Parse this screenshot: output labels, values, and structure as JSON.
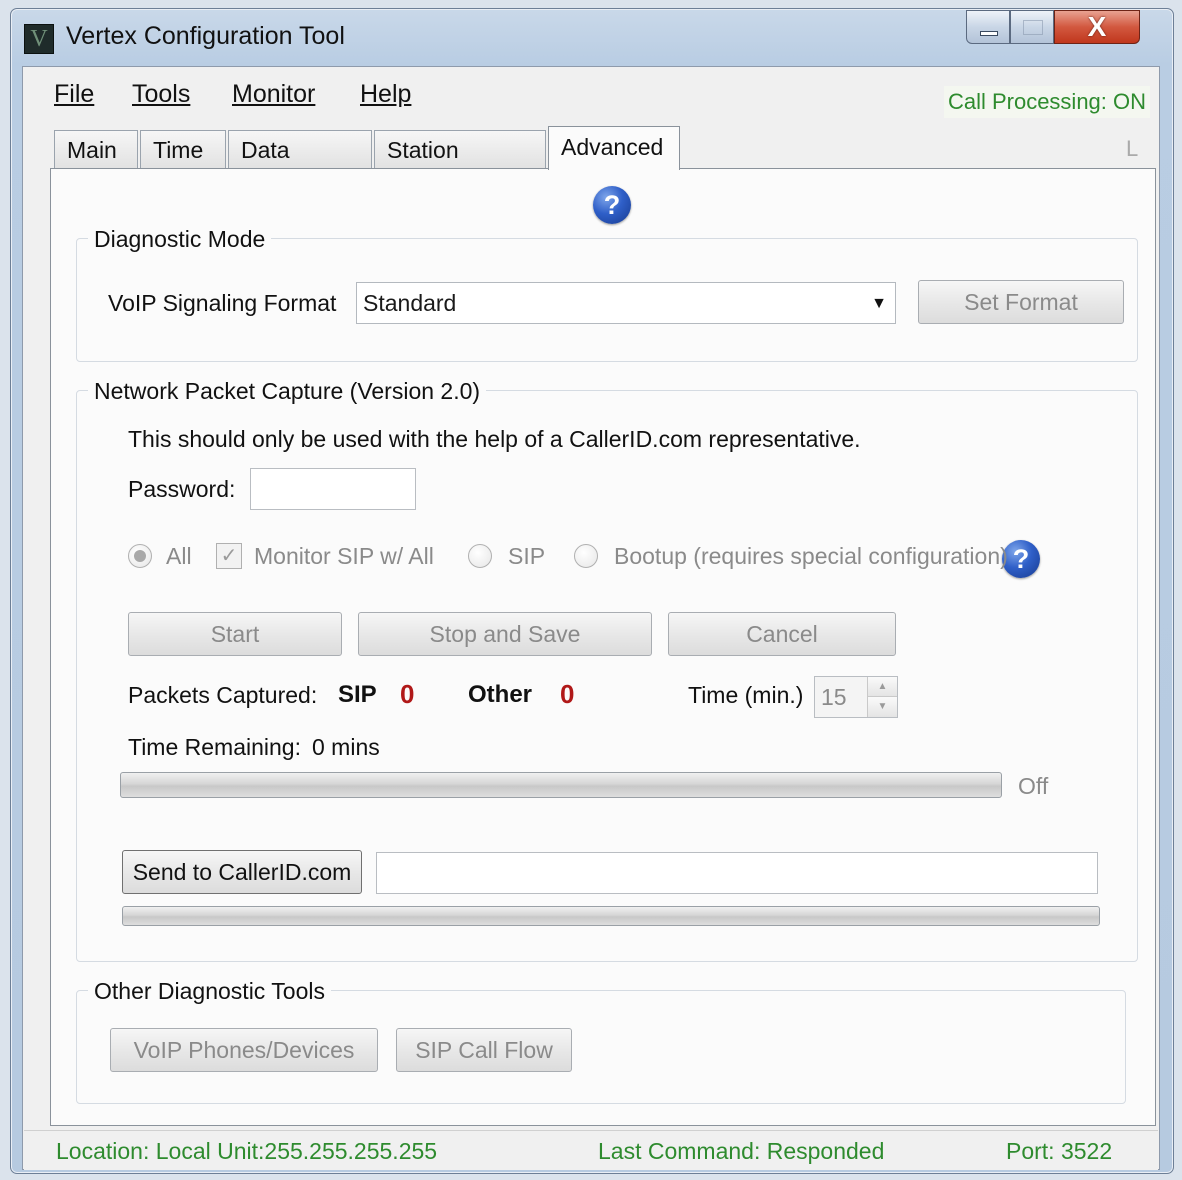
{
  "window": {
    "title": "Vertex Configuration Tool",
    "icon_letter": "V",
    "close_glyph": "X"
  },
  "menu": {
    "file": "File",
    "tools": "Tools",
    "monitor": "Monitor",
    "help": "Help"
  },
  "call_status": "Call Processing: ON",
  "tabs": [
    "Main",
    "Time",
    "Data Output",
    "Station Routing",
    "Advanced"
  ],
  "active_tab": "Advanced",
  "tab_right_marker": "L",
  "help_glyph": "?",
  "diagnostic_mode": {
    "title": "Diagnostic Mode",
    "format_label": "VoIP Signaling Format",
    "format_value": "Standard",
    "set_format_button": "Set Format"
  },
  "packet_capture": {
    "title": "Network Packet Capture  (Version 2.0)",
    "warning": "This should only be used with the help of a CallerID.com representative.",
    "password_label": "Password:",
    "password_value": "",
    "options": {
      "all": "All",
      "monitor_sip": "Monitor SIP w/ All",
      "sip": "SIP",
      "bootup": "Bootup (requires special configuration)"
    },
    "start_button": "Start",
    "stop_save_button": "Stop and Save",
    "cancel_button": "Cancel",
    "packets_label": "Packets Captured:",
    "sip_label": "SIP",
    "sip_count": "0",
    "other_label": "Other",
    "other_count": "0",
    "time_label": "Time (min.)",
    "time_value": "15",
    "remaining_label": "Time Remaining:",
    "remaining_value": "0 mins",
    "progress_state": "Off",
    "progress_fraction": 0,
    "send_button": "Send to CallerID.com",
    "send_status": "",
    "send_progress_fraction": 0
  },
  "other_tools": {
    "title": "Other Diagnostic Tools",
    "voip_button": "VoIP Phones/Devices",
    "sip_flow_button": "SIP Call Flow"
  },
  "statusbar": {
    "location": "Location: Local Unit:255.255.255.255",
    "last_command": "Last Command: Responded",
    "port": "Port: 3522"
  },
  "colors": {
    "status_green": "#2e8b2e",
    "counter_red": "#b01818"
  }
}
